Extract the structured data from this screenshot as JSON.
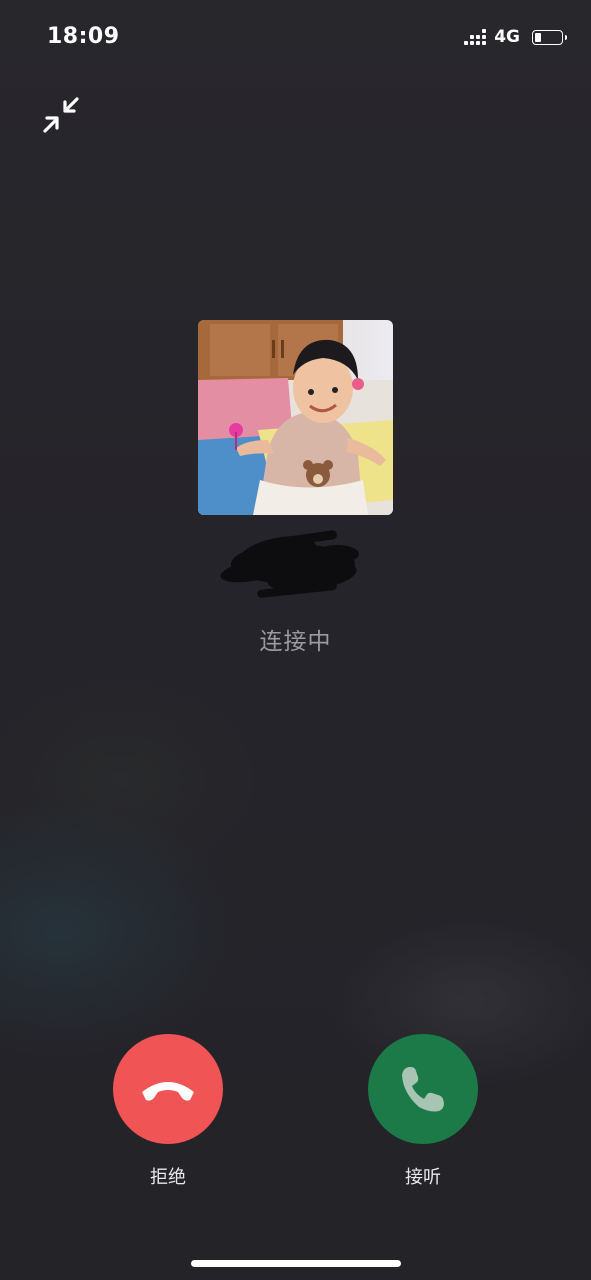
{
  "status_bar": {
    "time": "18:09",
    "network": "4G",
    "signal_icon": "signal-bars-icon",
    "battery_level": 0.25
  },
  "call": {
    "status": "连接中",
    "decline_label": "拒绝",
    "accept_label": "接听",
    "decline_color": "#f05454",
    "accept_color": "#1b7a48"
  },
  "icons": {
    "minimize": "minimize-arrows-icon",
    "decline": "hang-up-phone-icon",
    "accept": "phone-handset-icon"
  }
}
